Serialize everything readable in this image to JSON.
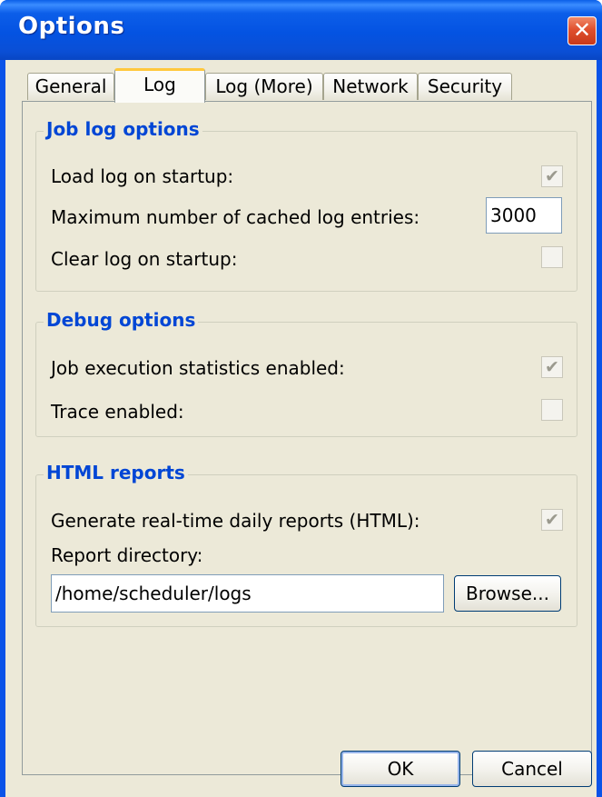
{
  "window": {
    "title": "Options",
    "close_glyph": "✕"
  },
  "tabs": [
    {
      "label": "General"
    },
    {
      "label": "Log",
      "active": true
    },
    {
      "label": "Log (More)"
    },
    {
      "label": "Network"
    },
    {
      "label": "Security"
    }
  ],
  "job_log": {
    "legend": "Job log options",
    "load_on_startup_label": "Load log on startup:",
    "load_on_startup_checked": true,
    "max_cached_label": "Maximum number of cached log entries:",
    "max_cached_value": "3000",
    "clear_on_startup_label": "Clear log on startup:",
    "clear_on_startup_checked": false
  },
  "debug": {
    "legend": "Debug options",
    "stats_label": "Job execution statistics enabled:",
    "stats_checked": true,
    "trace_label": "Trace enabled:",
    "trace_checked": false
  },
  "html_reports": {
    "legend": "HTML reports",
    "generate_label": "Generate real-time daily reports (HTML):",
    "generate_checked": true,
    "report_dir_label": "Report directory:",
    "report_dir_value": "/home/scheduler/logs",
    "browse_label": "Browse..."
  },
  "footer": {
    "ok_label": "OK",
    "cancel_label": "Cancel"
  },
  "icons": {
    "check_glyph": "✔"
  },
  "colors": {
    "titlebar": "#0453e2",
    "legend": "#0046d5",
    "checkmark_disabled": "#9b9a8e",
    "client_bg": "#ece9d8"
  }
}
